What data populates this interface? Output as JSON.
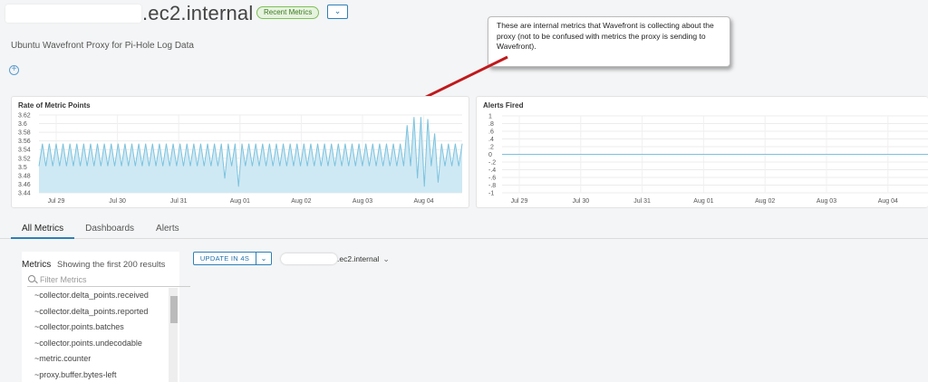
{
  "header": {
    "host_suffix": ".ec2.internal",
    "badge": "Recent Metrics",
    "dropdown_icon": "chevron-down-icon",
    "subtitle": "Ubuntu Wavefront Proxy for Pi-Hole Log Data"
  },
  "callout": {
    "text": "These are internal metrics that Wavefront is collecting about the proxy (not to be confused with metrics the proxy is sending to Wavefront)."
  },
  "colors": {
    "accent": "#2e7fb7",
    "series": "#7cc3de",
    "arrow": "#c0191c",
    "badge_green": "#7fbf5a"
  },
  "chart_data": [
    {
      "type": "area",
      "title": "Rate of Metric Points",
      "x_ticks": [
        "Jul 29",
        "Jul 30",
        "Jul 31",
        "Aug 01",
        "Aug 02",
        "Aug 03",
        "Aug 04"
      ],
      "y_ticks": [
        "3.62",
        "3.6",
        "3.58",
        "3.56",
        "3.54",
        "3.52",
        "3.5",
        "3.48",
        "3.46",
        "3.44"
      ],
      "ylim": [
        3.435,
        3.625
      ],
      "baseline": 3.5,
      "typical_peak": 3.555,
      "spike_peak": 3.62,
      "series": [
        {
          "values": [
            3.5,
            3.555,
            3.5,
            3.555,
            3.5,
            3.555,
            3.5,
            3.555,
            3.5,
            3.555,
            3.5,
            3.555,
            3.5,
            3.555,
            3.5,
            3.555,
            3.5,
            3.555,
            3.5,
            3.555,
            3.5,
            3.555,
            3.5,
            3.555,
            3.5,
            3.555,
            3.5,
            3.555,
            3.5,
            3.555,
            3.5,
            3.555,
            3.5,
            3.555,
            3.5,
            3.555,
            3.5,
            3.555,
            3.5,
            3.555,
            3.5,
            3.555,
            3.5,
            3.555,
            3.5,
            3.555,
            3.5,
            3.555,
            3.5,
            3.555,
            3.5,
            3.555,
            3.5,
            3.555,
            3.47,
            3.555,
            3.5,
            3.555,
            3.45,
            3.555,
            3.5,
            3.555,
            3.5,
            3.555,
            3.5,
            3.555,
            3.5,
            3.555,
            3.5,
            3.555,
            3.5,
            3.555,
            3.5,
            3.555,
            3.5,
            3.555,
            3.5,
            3.555,
            3.5,
            3.555,
            3.5,
            3.555,
            3.5,
            3.555,
            3.5,
            3.555,
            3.5,
            3.555,
            3.5,
            3.555,
            3.5,
            3.555,
            3.5,
            3.555,
            3.5,
            3.555,
            3.5,
            3.555,
            3.5,
            3.555,
            3.5,
            3.555,
            3.5,
            3.555,
            3.5,
            3.555,
            3.5,
            3.6,
            3.5,
            3.62,
            3.47,
            3.62,
            3.45,
            3.615,
            3.5,
            3.58,
            3.46,
            3.555,
            3.5,
            3.555,
            3.5,
            3.555,
            3.5,
            3.555
          ]
        }
      ]
    },
    {
      "type": "line",
      "title": "Alerts Fired",
      "x_ticks": [
        "Jul 29",
        "Jul 30",
        "Jul 31",
        "Aug 01",
        "Aug 02",
        "Aug 03",
        "Aug 04"
      ],
      "y_ticks": [
        "1",
        ".8",
        ".6",
        ".4",
        ".2",
        "0",
        "-.2",
        "-.4",
        "-.6",
        "-.8",
        "-1"
      ],
      "ylim": [
        -1,
        1
      ],
      "series": [
        {
          "values": [
            0,
            0
          ]
        }
      ]
    }
  ],
  "tabs": [
    {
      "label": "All Metrics",
      "active": true
    },
    {
      "label": "Dashboards",
      "active": false
    },
    {
      "label": "Alerts",
      "active": false
    }
  ],
  "metrics": {
    "label": "Metrics",
    "count_text": "Showing the first 200 results",
    "filter_placeholder": "Filter Metrics",
    "items": [
      "~collector.delta_points.received",
      "~collector.delta_points.reported",
      "~collector.points.batches",
      "~collector.points.undecodable",
      "~metric.counter",
      "~proxy.buffer.bytes-left"
    ]
  },
  "controls": {
    "update_label": "UPDATE IN 4S",
    "source_suffix": ".ec2.internal"
  }
}
